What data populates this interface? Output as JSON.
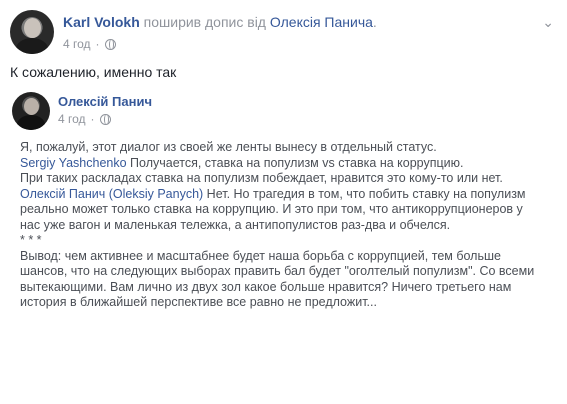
{
  "header": {
    "author": "Karl Volokh",
    "action": " поширив допис від ",
    "original_author": "Олексія Панича",
    "period": ".",
    "time": "4 год",
    "separator": "·"
  },
  "post_text": "К сожалению, именно так",
  "shared": {
    "author": "Олексій Панич",
    "time": "4 год",
    "separator": "·",
    "paragraphs": {
      "p1": "Я, пожалуй, этот диалог из своей же ленты вынесу в отдельный статус.",
      "p2_name": "Sergiy Yashchenko",
      "p2_text": " Получается, ставка на популизм vs ставка на коррупцию.",
      "p3": "При таких раскладах ставка на популизм побеждает, нравится это кому-то или нет.",
      "p4_name": "Олексій Панич (Oleksiy Panych)",
      "p4_text": " Нет. Но трагедия в том, что побить ставку на популизм реально может только ставка на коррупцию. И это при том, что антикоррупционеров у нас уже вагон и маленькая тележка, а антипопулистов раз-два и обчелся.",
      "p5": "* * *",
      "p6": "Вывод: чем активнее и масштабнее будет наша борьба с коррупцией, тем больше шансов, что на следующих выборах править бал будет \"оголтелый популизм\". Со всеми вытекающими. Вам лично из двух зол какое больше нравится? Ничего третьего нам история в ближайшей перспективе все равно не предложит..."
    }
  }
}
